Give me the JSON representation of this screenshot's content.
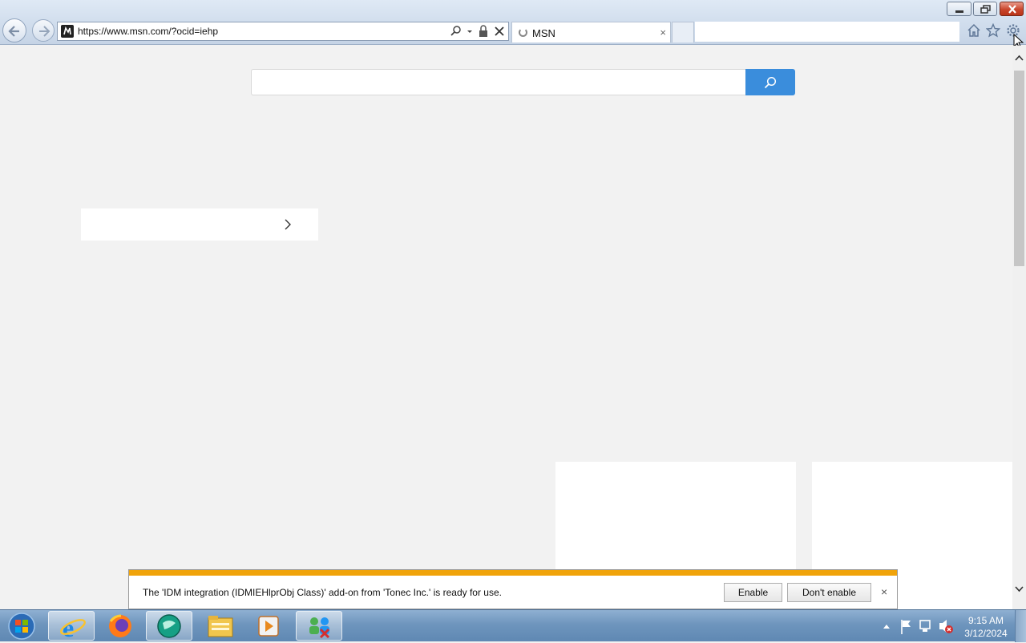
{
  "browser": {
    "address": {
      "url": "https://www.msn.com/?ocid=iehp"
    },
    "tab": {
      "title": "MSN",
      "close_glyph": "×"
    }
  },
  "page": {
    "search": {
      "placeholder": ""
    }
  },
  "notification": {
    "message": "The 'IDM integration (IDMIEHlprObj Class)' add-on from 'Tonec Inc.' is ready for use.",
    "enable_label": "Enable",
    "dont_enable_label": "Don't enable",
    "close_glyph": "×",
    "accent_color": "#f0a30a"
  },
  "taskbar": {
    "apps": [
      {
        "name": "internet-explorer-icon",
        "active": true
      },
      {
        "name": "firefox-icon",
        "active": false
      },
      {
        "name": "chat-app-icon",
        "active": false
      },
      {
        "name": "file-explorer-icon",
        "active": false
      },
      {
        "name": "media-player-icon",
        "active": false
      },
      {
        "name": "network-app-icon",
        "active": true
      }
    ],
    "clock": {
      "time": "9:15 AM",
      "date": "3/12/2024"
    }
  },
  "colors": {
    "search_button": "#3a8ddc",
    "page_background": "#f2f2f2"
  }
}
